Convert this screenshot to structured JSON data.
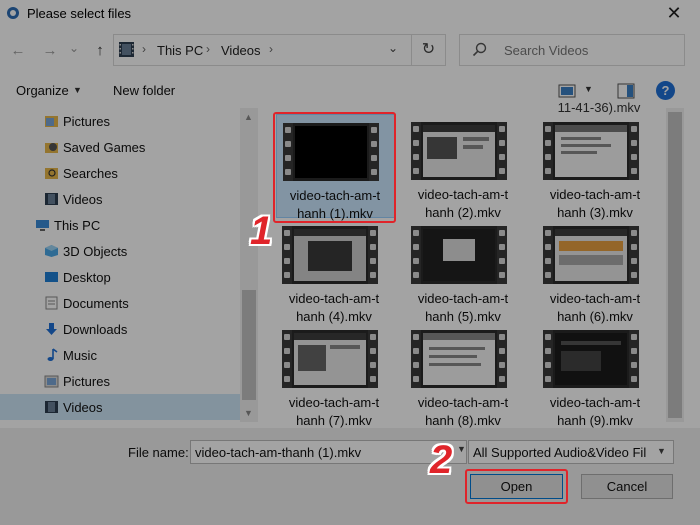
{
  "window": {
    "title": "Please select files",
    "close_glyph": "✕"
  },
  "nav": {
    "back_glyph": "←",
    "forward_glyph": "→",
    "dropdown_glyph": "⌄",
    "up_glyph": "↑",
    "breadcrumb": [
      "This PC",
      "Videos"
    ],
    "separator": "›",
    "refresh_glyph": "↻",
    "search_placeholder": "Search Videos"
  },
  "toolbar": {
    "organize": "Organize",
    "new_folder": "New folder",
    "help": "?"
  },
  "sidebar": [
    {
      "label": "Pictures",
      "icon": "pictures-folder-icon"
    },
    {
      "label": "Saved Games",
      "icon": "saved-games-icon"
    },
    {
      "label": "Searches",
      "icon": "searches-icon"
    },
    {
      "label": "Videos",
      "icon": "videos-folder-icon"
    },
    {
      "label": "This PC",
      "icon": "this-pc-icon"
    },
    {
      "label": "3D Objects",
      "icon": "3d-objects-icon"
    },
    {
      "label": "Desktop",
      "icon": "desktop-icon"
    },
    {
      "label": "Documents",
      "icon": "documents-icon"
    },
    {
      "label": "Downloads",
      "icon": "downloads-icon"
    },
    {
      "label": "Music",
      "icon": "music-icon"
    },
    {
      "label": "Pictures",
      "icon": "pictures-folder-icon"
    },
    {
      "label": "Videos",
      "icon": "videos-folder-icon",
      "selected": true
    }
  ],
  "files": {
    "partial_top": "11-41-36).mkv",
    "items": [
      {
        "line1": "video-tach-am-t",
        "line2": "hanh (1).mkv",
        "selected": true
      },
      {
        "line1": "video-tach-am-t",
        "line2": "hanh (2).mkv"
      },
      {
        "line1": "video-tach-am-t",
        "line2": "hanh (3).mkv"
      },
      {
        "line1": "video-tach-am-t",
        "line2": "hanh (4).mkv"
      },
      {
        "line1": "video-tach-am-t",
        "line2": "hanh (5).mkv"
      },
      {
        "line1": "video-tach-am-t",
        "line2": "hanh (6).mkv"
      },
      {
        "line1": "video-tach-am-t",
        "line2": "hanh (7).mkv"
      },
      {
        "line1": "video-tach-am-t",
        "line2": "hanh (8).mkv"
      },
      {
        "line1": "video-tach-am-t",
        "line2": "hanh (9).mkv"
      }
    ]
  },
  "bottom": {
    "file_name_label": "File name:",
    "file_name_value": "video-tach-am-thanh (1).mkv",
    "file_type": "All Supported Audio&Video Fil",
    "open": "Open",
    "cancel": "Cancel"
  },
  "annotations": {
    "step1": "1",
    "step2": "2",
    "color": "#e0242a"
  }
}
